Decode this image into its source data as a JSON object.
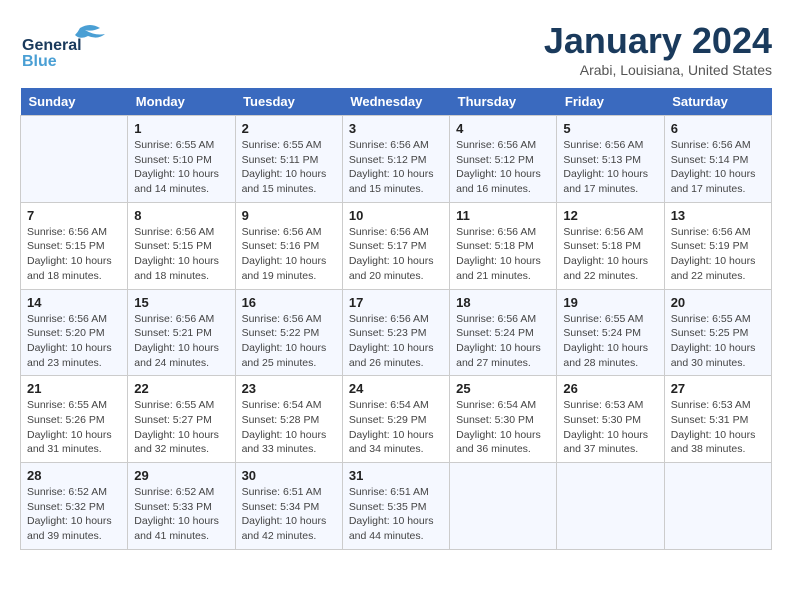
{
  "logo": {
    "line1": "General",
    "line2": "Blue"
  },
  "title": "January 2024",
  "subtitle": "Arabi, Louisiana, United States",
  "days_of_week": [
    "Sunday",
    "Monday",
    "Tuesday",
    "Wednesday",
    "Thursday",
    "Friday",
    "Saturday"
  ],
  "weeks": [
    [
      {
        "day": "",
        "sunrise": "",
        "sunset": "",
        "daylight": ""
      },
      {
        "day": "1",
        "sunrise": "Sunrise: 6:55 AM",
        "sunset": "Sunset: 5:10 PM",
        "daylight": "Daylight: 10 hours and 14 minutes."
      },
      {
        "day": "2",
        "sunrise": "Sunrise: 6:55 AM",
        "sunset": "Sunset: 5:11 PM",
        "daylight": "Daylight: 10 hours and 15 minutes."
      },
      {
        "day": "3",
        "sunrise": "Sunrise: 6:56 AM",
        "sunset": "Sunset: 5:12 PM",
        "daylight": "Daylight: 10 hours and 15 minutes."
      },
      {
        "day": "4",
        "sunrise": "Sunrise: 6:56 AM",
        "sunset": "Sunset: 5:12 PM",
        "daylight": "Daylight: 10 hours and 16 minutes."
      },
      {
        "day": "5",
        "sunrise": "Sunrise: 6:56 AM",
        "sunset": "Sunset: 5:13 PM",
        "daylight": "Daylight: 10 hours and 17 minutes."
      },
      {
        "day": "6",
        "sunrise": "Sunrise: 6:56 AM",
        "sunset": "Sunset: 5:14 PM",
        "daylight": "Daylight: 10 hours and 17 minutes."
      }
    ],
    [
      {
        "day": "7",
        "sunrise": "Sunrise: 6:56 AM",
        "sunset": "Sunset: 5:15 PM",
        "daylight": "Daylight: 10 hours and 18 minutes."
      },
      {
        "day": "8",
        "sunrise": "Sunrise: 6:56 AM",
        "sunset": "Sunset: 5:15 PM",
        "daylight": "Daylight: 10 hours and 18 minutes."
      },
      {
        "day": "9",
        "sunrise": "Sunrise: 6:56 AM",
        "sunset": "Sunset: 5:16 PM",
        "daylight": "Daylight: 10 hours and 19 minutes."
      },
      {
        "day": "10",
        "sunrise": "Sunrise: 6:56 AM",
        "sunset": "Sunset: 5:17 PM",
        "daylight": "Daylight: 10 hours and 20 minutes."
      },
      {
        "day": "11",
        "sunrise": "Sunrise: 6:56 AM",
        "sunset": "Sunset: 5:18 PM",
        "daylight": "Daylight: 10 hours and 21 minutes."
      },
      {
        "day": "12",
        "sunrise": "Sunrise: 6:56 AM",
        "sunset": "Sunset: 5:18 PM",
        "daylight": "Daylight: 10 hours and 22 minutes."
      },
      {
        "day": "13",
        "sunrise": "Sunrise: 6:56 AM",
        "sunset": "Sunset: 5:19 PM",
        "daylight": "Daylight: 10 hours and 22 minutes."
      }
    ],
    [
      {
        "day": "14",
        "sunrise": "Sunrise: 6:56 AM",
        "sunset": "Sunset: 5:20 PM",
        "daylight": "Daylight: 10 hours and 23 minutes."
      },
      {
        "day": "15",
        "sunrise": "Sunrise: 6:56 AM",
        "sunset": "Sunset: 5:21 PM",
        "daylight": "Daylight: 10 hours and 24 minutes."
      },
      {
        "day": "16",
        "sunrise": "Sunrise: 6:56 AM",
        "sunset": "Sunset: 5:22 PM",
        "daylight": "Daylight: 10 hours and 25 minutes."
      },
      {
        "day": "17",
        "sunrise": "Sunrise: 6:56 AM",
        "sunset": "Sunset: 5:23 PM",
        "daylight": "Daylight: 10 hours and 26 minutes."
      },
      {
        "day": "18",
        "sunrise": "Sunrise: 6:56 AM",
        "sunset": "Sunset: 5:24 PM",
        "daylight": "Daylight: 10 hours and 27 minutes."
      },
      {
        "day": "19",
        "sunrise": "Sunrise: 6:55 AM",
        "sunset": "Sunset: 5:24 PM",
        "daylight": "Daylight: 10 hours and 28 minutes."
      },
      {
        "day": "20",
        "sunrise": "Sunrise: 6:55 AM",
        "sunset": "Sunset: 5:25 PM",
        "daylight": "Daylight: 10 hours and 30 minutes."
      }
    ],
    [
      {
        "day": "21",
        "sunrise": "Sunrise: 6:55 AM",
        "sunset": "Sunset: 5:26 PM",
        "daylight": "Daylight: 10 hours and 31 minutes."
      },
      {
        "day": "22",
        "sunrise": "Sunrise: 6:55 AM",
        "sunset": "Sunset: 5:27 PM",
        "daylight": "Daylight: 10 hours and 32 minutes."
      },
      {
        "day": "23",
        "sunrise": "Sunrise: 6:54 AM",
        "sunset": "Sunset: 5:28 PM",
        "daylight": "Daylight: 10 hours and 33 minutes."
      },
      {
        "day": "24",
        "sunrise": "Sunrise: 6:54 AM",
        "sunset": "Sunset: 5:29 PM",
        "daylight": "Daylight: 10 hours and 34 minutes."
      },
      {
        "day": "25",
        "sunrise": "Sunrise: 6:54 AM",
        "sunset": "Sunset: 5:30 PM",
        "daylight": "Daylight: 10 hours and 36 minutes."
      },
      {
        "day": "26",
        "sunrise": "Sunrise: 6:53 AM",
        "sunset": "Sunset: 5:30 PM",
        "daylight": "Daylight: 10 hours and 37 minutes."
      },
      {
        "day": "27",
        "sunrise": "Sunrise: 6:53 AM",
        "sunset": "Sunset: 5:31 PM",
        "daylight": "Daylight: 10 hours and 38 minutes."
      }
    ],
    [
      {
        "day": "28",
        "sunrise": "Sunrise: 6:52 AM",
        "sunset": "Sunset: 5:32 PM",
        "daylight": "Daylight: 10 hours and 39 minutes."
      },
      {
        "day": "29",
        "sunrise": "Sunrise: 6:52 AM",
        "sunset": "Sunset: 5:33 PM",
        "daylight": "Daylight: 10 hours and 41 minutes."
      },
      {
        "day": "30",
        "sunrise": "Sunrise: 6:51 AM",
        "sunset": "Sunset: 5:34 PM",
        "daylight": "Daylight: 10 hours and 42 minutes."
      },
      {
        "day": "31",
        "sunrise": "Sunrise: 6:51 AM",
        "sunset": "Sunset: 5:35 PM",
        "daylight": "Daylight: 10 hours and 44 minutes."
      },
      {
        "day": "",
        "sunrise": "",
        "sunset": "",
        "daylight": ""
      },
      {
        "day": "",
        "sunrise": "",
        "sunset": "",
        "daylight": ""
      },
      {
        "day": "",
        "sunrise": "",
        "sunset": "",
        "daylight": ""
      }
    ]
  ]
}
